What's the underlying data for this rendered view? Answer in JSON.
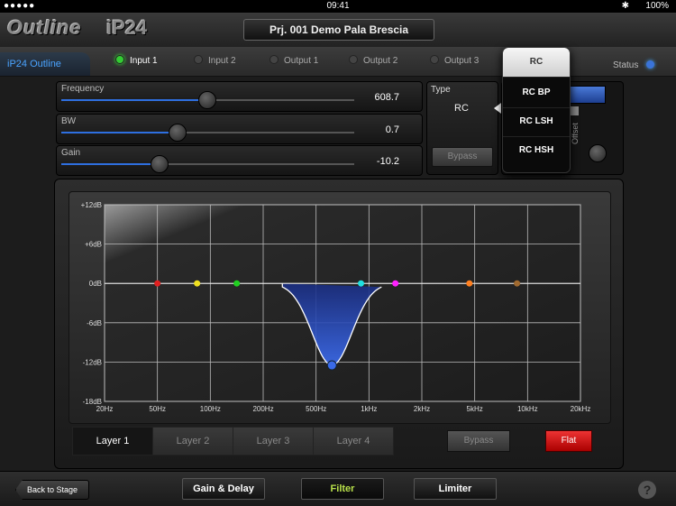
{
  "status_bar": {
    "signal": "●●●●●",
    "time": "09:41",
    "bluetooth": "✱",
    "battery": "100%"
  },
  "header": {
    "logo": "Outline",
    "model": "iP24",
    "project": "Prj. 001 Demo Pala Brescia"
  },
  "tabs": {
    "device_name": "iP24 Outline",
    "items": [
      {
        "label": "Input 1",
        "active": true
      },
      {
        "label": "Input 2",
        "active": false
      },
      {
        "label": "Output 1",
        "active": false
      },
      {
        "label": "Output 2",
        "active": false
      },
      {
        "label": "Output 3",
        "active": false
      }
    ],
    "status_label": "Status"
  },
  "params": {
    "frequency": {
      "label": "Frequency",
      "value": "608.7",
      "position": 0.5
    },
    "bw": {
      "label": "BW",
      "value": "0.7",
      "position": 0.4
    },
    "gain": {
      "label": "Gain",
      "value": "-10.2",
      "position": 0.34
    }
  },
  "type_panel": {
    "label": "Type",
    "value": "RC",
    "bypass": "Bypass"
  },
  "right_panel": {
    "offset_label": "Offset"
  },
  "dropdown": {
    "items": [
      "RC",
      "RC BP",
      "RC LSH",
      "RC HSH"
    ],
    "selected": "RC"
  },
  "graph": {
    "y_labels": [
      "+12dB",
      "+6dB",
      "0dB",
      "-6dB",
      "-12dB",
      "-18dB"
    ],
    "x_labels": [
      "20Hz",
      "50Hz",
      "100Hz",
      "200Hz",
      "500Hz",
      "1kHz",
      "2kHz",
      "5kHz",
      "10kHz",
      "20kHz"
    ],
    "band_colors": [
      "#e02020",
      "#f0e020",
      "#20d020",
      "#20a0ff",
      "#20e0e0",
      "#ff20ff",
      "#ff8020",
      "#a06a30"
    ],
    "curve_color": "#2f55c8"
  },
  "layers": {
    "items": [
      "Layer 1",
      "Layer 2",
      "Layer 3",
      "Layer 4"
    ],
    "active": "Layer 1"
  },
  "bottom": {
    "bypass": "Bypass",
    "flat": "Flat"
  },
  "footer": {
    "back": "Back to Stage",
    "gain_delay": "Gain & Delay",
    "filter": "Filter",
    "limiter": "Limiter",
    "help": "?"
  }
}
